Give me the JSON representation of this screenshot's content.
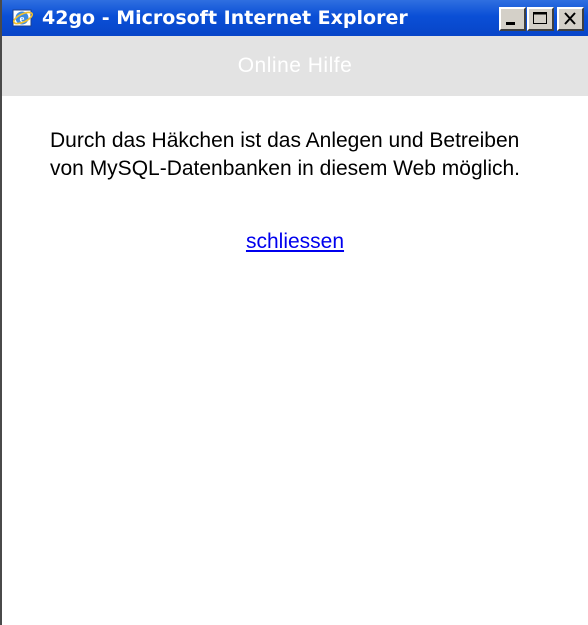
{
  "window": {
    "title": "42go - Microsoft Internet Explorer",
    "controls": [
      "minimize",
      "maximize",
      "close"
    ]
  },
  "header": {
    "title": "Online Hilfe"
  },
  "help": {
    "text": "Durch das Häkchen ist das Anlegen und Betreiben von MySQL-Datenbanken in diesem Web möglich.",
    "close_link": "schliessen"
  },
  "colors": {
    "titlebar": "#0a4fd6",
    "header_band": "#e3e3e3",
    "link": "#0000ee"
  },
  "icons": [
    "internet-explorer-icon",
    "minimize-icon",
    "maximize-icon",
    "close-icon"
  ]
}
